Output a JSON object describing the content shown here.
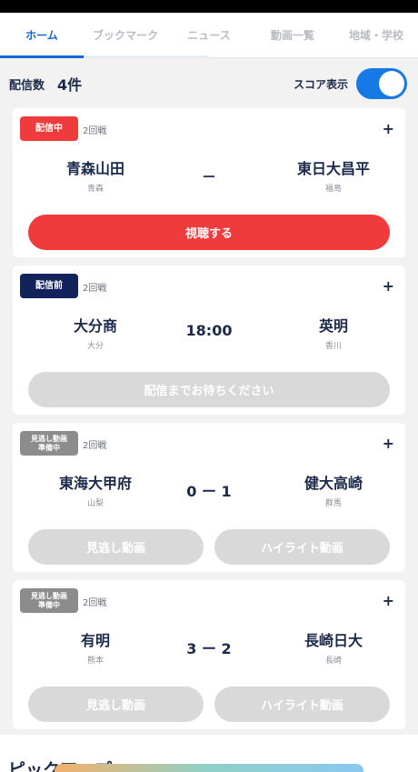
{
  "tabs": [
    {
      "label": "ホーム"
    },
    {
      "label": "ブックマーク"
    },
    {
      "label": "ニュース"
    },
    {
      "label": "動画一覧"
    },
    {
      "label": "地域・学校"
    }
  ],
  "summary": {
    "count_label": "配信数",
    "count_value": "4件",
    "score_label": "スコア表示",
    "score_toggle_on": true
  },
  "matches": [
    {
      "badge": "配信中",
      "round": "2回戦",
      "home": {
        "name": "青森山田",
        "pref": "青森"
      },
      "center": "－",
      "away": {
        "name": "東日大昌平",
        "pref": "福島"
      },
      "button": "視聴する"
    },
    {
      "badge": "配信前",
      "round": "2回戦",
      "home": {
        "name": "大分商",
        "pref": "大分"
      },
      "center": "18:00",
      "away": {
        "name": "英明",
        "pref": "香川"
      },
      "button": "配信までお待ちください"
    },
    {
      "badge": "見逃し動画\n準備中",
      "round": "2回戦",
      "home": {
        "name": "東海大甲府",
        "pref": "山梨"
      },
      "center": "0 ー 1",
      "away": {
        "name": "健大高崎",
        "pref": "群馬"
      },
      "button_left": "見逃し動画",
      "button_right": "ハイライト動画"
    },
    {
      "badge": "見逃し動画\n準備中",
      "round": "2回戦",
      "home": {
        "name": "有明",
        "pref": "熊本"
      },
      "center": "3 ー 2",
      "away": {
        "name": "長崎日大",
        "pref": "長崎"
      },
      "button_left": "見逃し動画",
      "button_right": "ハイライト動画"
    }
  ],
  "pickup": {
    "title": "ピックアップ"
  },
  "colors": {
    "accent": "#1565d8",
    "live": "#ef3b3b",
    "pre": "#12225a",
    "disabled": "#d9d9d9"
  }
}
